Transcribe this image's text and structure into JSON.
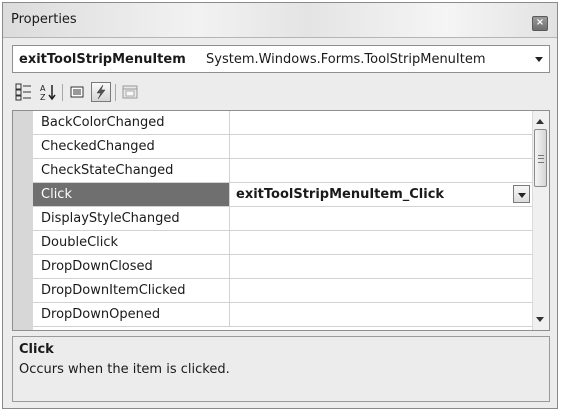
{
  "window": {
    "title": "Properties"
  },
  "object_selector": {
    "name": "exitToolStripMenuItem",
    "type": "System.Windows.Forms.ToolStripMenuItem"
  },
  "toolbar": {
    "buttons": [
      {
        "icon": "categorized-icon",
        "active": false
      },
      {
        "icon": "alphabetical-icon",
        "active": false
      },
      {
        "icon": "properties-icon",
        "active": false
      },
      {
        "icon": "events-icon",
        "active": true
      },
      {
        "icon": "property-pages-icon",
        "active": false
      }
    ]
  },
  "grid": {
    "rows": [
      {
        "name": "BackColorChanged",
        "value": ""
      },
      {
        "name": "CheckedChanged",
        "value": ""
      },
      {
        "name": "CheckStateChanged",
        "value": ""
      },
      {
        "name": "Click",
        "value": "exitToolStripMenuItem_Click",
        "selected": true
      },
      {
        "name": "DisplayStyleChanged",
        "value": ""
      },
      {
        "name": "DoubleClick",
        "value": ""
      },
      {
        "name": "DropDownClosed",
        "value": ""
      },
      {
        "name": "DropDownItemClicked",
        "value": ""
      },
      {
        "name": "DropDownOpened",
        "value": ""
      }
    ]
  },
  "description": {
    "title": "Click",
    "text": "Occurs when the item is clicked."
  },
  "colors": {
    "selected_row": "#6f6f6f",
    "grid_margin": "#d7d7d7"
  }
}
